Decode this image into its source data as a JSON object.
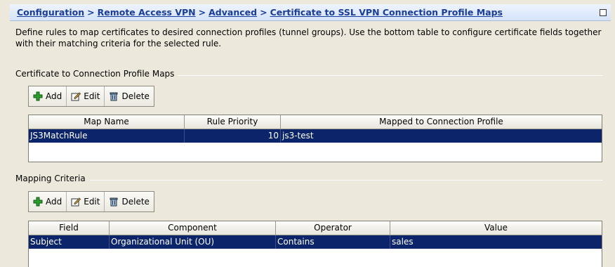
{
  "breadcrumb": {
    "items": [
      "Configuration",
      "Remote Access VPN",
      "Advanced"
    ],
    "current": "Certificate to SSL VPN Connection Profile Maps",
    "separator": ">"
  },
  "description": "Define rules to map certificates to desired connection profiles (tunnel groups). Use the bottom table to configure certificate fields together with their matching criteria for the selected rule.",
  "maps_section": {
    "title": "Certificate to Connection Profile Maps",
    "toolbar": {
      "add": "Add",
      "edit": "Edit",
      "delete": "Delete"
    },
    "columns": [
      "Map Name",
      "Rule Priority",
      "Mapped to Connection Profile"
    ],
    "rows": [
      {
        "map_name": "JS3MatchRule",
        "rule_priority": "10",
        "profile": "js3-test",
        "selected": true
      }
    ]
  },
  "criteria_section": {
    "title": "Mapping Criteria",
    "toolbar": {
      "add": "Add",
      "edit": "Edit",
      "delete": "Delete"
    },
    "columns": [
      "Field",
      "Component",
      "Operator",
      "Value"
    ],
    "rows": [
      {
        "field": "Subject",
        "component": "Organizational Unit (OU)",
        "operator": "Contains",
        "value": "sales",
        "selected": true
      }
    ]
  },
  "colors": {
    "accent": "#1a3d99",
    "selection": "#0b246a",
    "background": "#ece9dc"
  }
}
